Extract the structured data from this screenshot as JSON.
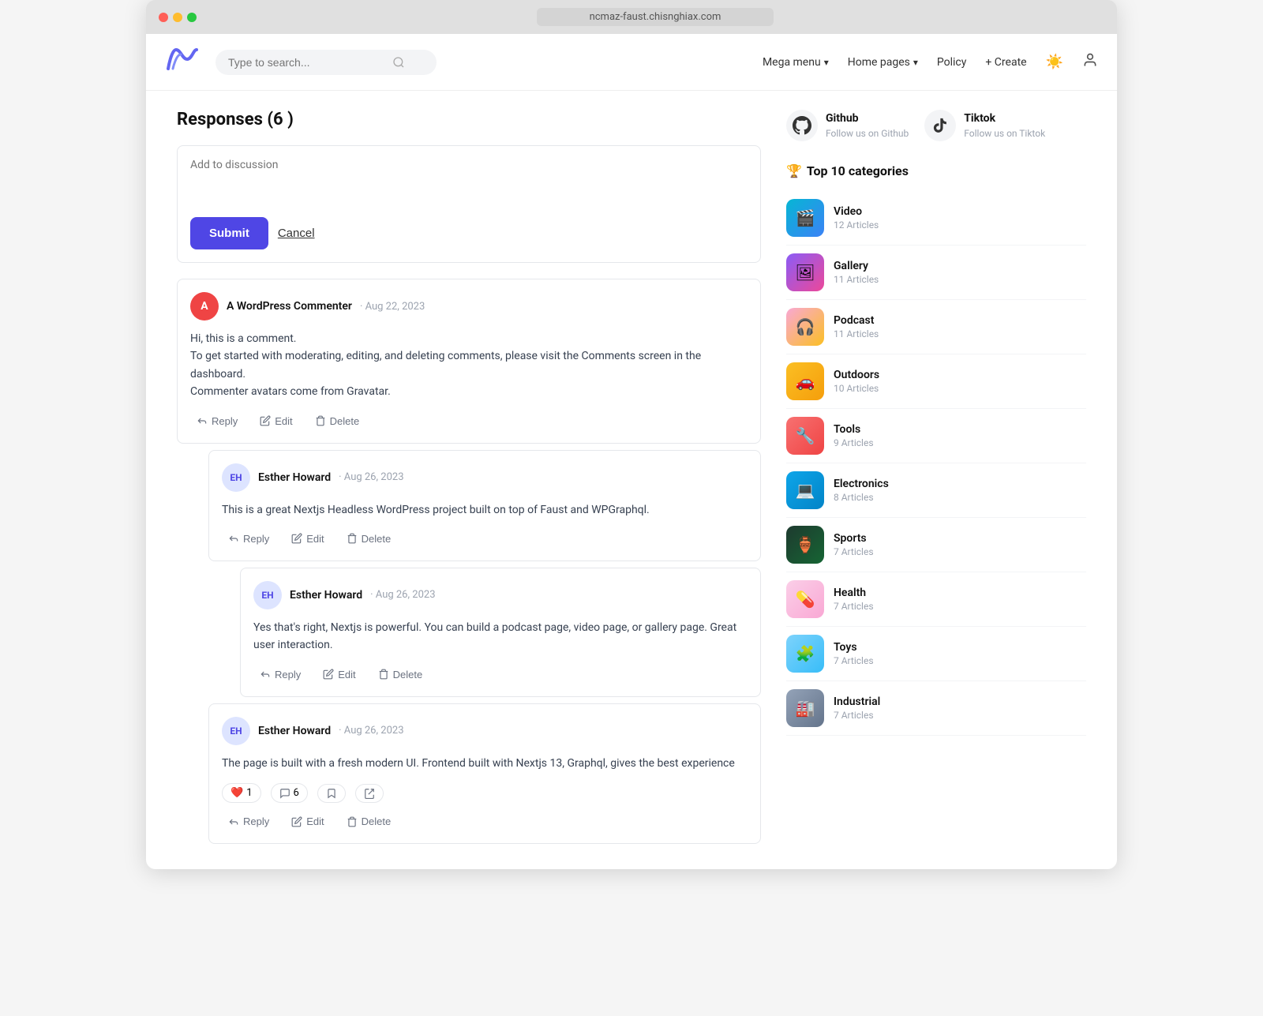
{
  "browser": {
    "url": "ncmaz-faust.chisnghiax.com"
  },
  "header": {
    "logo": "//",
    "search_placeholder": "Type to search...",
    "nav_items": [
      {
        "label": "Mega menu",
        "has_chevron": true
      },
      {
        "label": "Home pages",
        "has_chevron": true
      },
      {
        "label": "Policy",
        "has_chevron": false
      }
    ],
    "create_label": "+ Create",
    "sun_icon": "☀",
    "user_icon": "👤"
  },
  "responses": {
    "title": "Responses (6 )",
    "add_placeholder": "Add to discussion",
    "submit_label": "Submit",
    "cancel_label": "Cancel"
  },
  "comments": [
    {
      "id": "c1",
      "author": "A WordPress Commenter",
      "author_initial": "A",
      "date": "Aug 22, 2023",
      "body_lines": [
        "Hi, this is a comment.",
        "To get started with moderating, editing, and deleting comments, please visit the Comments screen in the dashboard.",
        "Commenter avatars come from Gravatar."
      ],
      "actions": [
        "Reply",
        "Edit",
        "Delete"
      ],
      "nested": [
        {
          "id": "c1-1",
          "author": "Esther Howard",
          "date": "Aug 26, 2023",
          "body": "This is a great Nextjs Headless WordPress project built on top of Faust and WPGraphql.",
          "actions": [
            "Reply",
            "Edit",
            "Delete"
          ],
          "nested": [
            {
              "id": "c1-1-1",
              "author": "Esther Howard",
              "date": "Aug 26, 2023",
              "body": "Yes that's right, Nextjs is powerful. You can build a podcast page, video page, or gallery page. Great user interaction.",
              "actions": [
                "Reply",
                "Edit",
                "Delete"
              ]
            }
          ]
        },
        {
          "id": "c1-2",
          "author": "Esther Howard",
          "date": "Aug 26, 2023",
          "body": "The page is built with a fresh modern UI. Frontend built with Nextjs 13, Graphql, gives the best experience",
          "reactions": {
            "heart": 1,
            "comment": 6
          },
          "actions": [
            "Reply",
            "Edit",
            "Delete"
          ]
        }
      ]
    }
  ],
  "sidebar": {
    "github": {
      "name": "Github",
      "follow": "Follow us on Github"
    },
    "tiktok": {
      "name": "Tiktok",
      "follow": "Follow us on Tiktok"
    },
    "categories_title": "Top 10 categories",
    "categories": [
      {
        "name": "Video",
        "count": "12 Articles",
        "emoji": "🎬",
        "class": "cat-video"
      },
      {
        "name": "Gallery",
        "count": "11 Articles",
        "emoji": "🖼",
        "class": "cat-gallery"
      },
      {
        "name": "Podcast",
        "count": "11 Articles",
        "emoji": "🎧",
        "class": "cat-podcast"
      },
      {
        "name": "Outdoors",
        "count": "10 Articles",
        "emoji": "🚗",
        "class": "cat-outdoors"
      },
      {
        "name": "Tools",
        "count": "9 Articles",
        "emoji": "🔧",
        "class": "cat-tools"
      },
      {
        "name": "Electronics",
        "count": "8 Articles",
        "emoji": "💻",
        "class": "cat-electronics"
      },
      {
        "name": "Sports",
        "count": "7 Articles",
        "emoji": "🏺",
        "class": "cat-sports"
      },
      {
        "name": "Health",
        "count": "7 Articles",
        "emoji": "💊",
        "class": "cat-health"
      },
      {
        "name": "Toys",
        "count": "7 Articles",
        "emoji": "🧩",
        "class": "cat-toys"
      },
      {
        "name": "Industrial",
        "count": "7 Articles",
        "emoji": "🏭",
        "class": "cat-industrial"
      }
    ]
  }
}
